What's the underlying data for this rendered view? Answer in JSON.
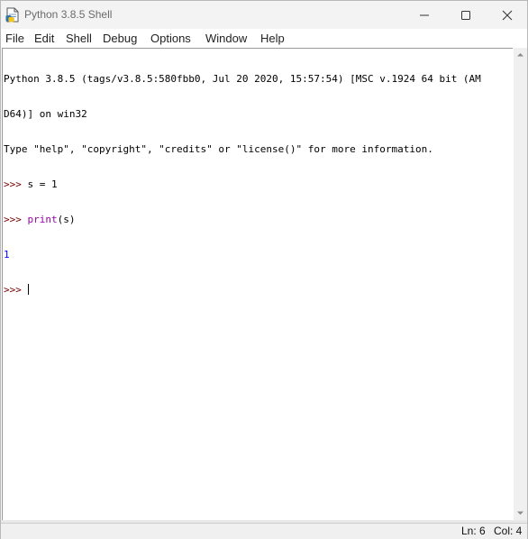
{
  "window": {
    "title": "Python 3.8.5 Shell",
    "icons": {
      "app": "python-idle-icon",
      "minimize": "minimize-icon",
      "maximize": "maximize-icon",
      "close": "close-icon"
    }
  },
  "menubar": {
    "items": [
      "File",
      "Edit",
      "Shell",
      "Debug",
      "Options",
      "Window",
      "Help"
    ]
  },
  "shell": {
    "banner_line1": "Python 3.8.5 (tags/v3.8.5:580fbb0, Jul 20 2020, 15:57:54) [MSC v.1924 64 bit (AM",
    "banner_line2": "D64)] on win32",
    "banner_line3": "Type \"help\", \"copyright\", \"credits\" or \"license()\" for more information.",
    "prompt": ">>> ",
    "input1": "s = 1",
    "input2_func": "print",
    "input2_args": "(s)",
    "output1": "1"
  },
  "statusbar": {
    "ln": "Ln: 6",
    "col": "Col: 4"
  },
  "colors": {
    "prompt": "#770000",
    "builtin": "#9900a8",
    "stdout": "#0000ff",
    "titlebar": "#f3f3f3"
  }
}
